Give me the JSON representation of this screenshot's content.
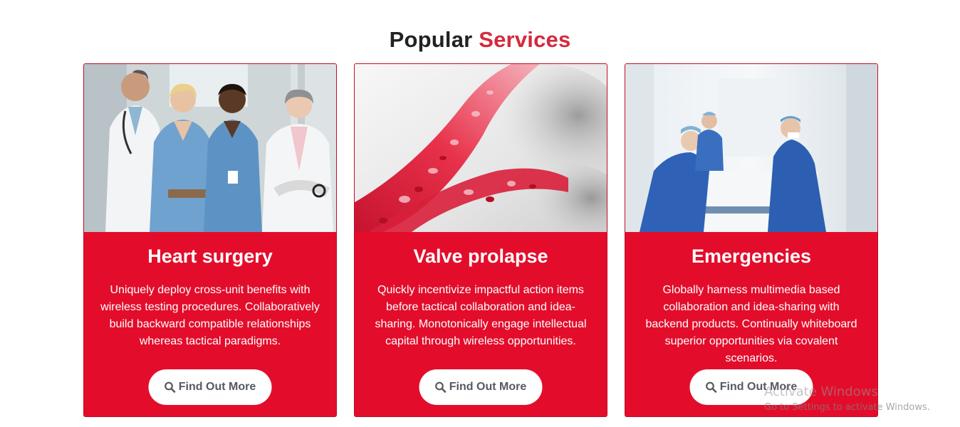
{
  "section": {
    "title_part1": "Popular",
    "title_part2": "Services",
    "accent_color": "#d42a3c"
  },
  "cards": [
    {
      "title": "Heart surgery",
      "description": "Uniquely deploy cross-unit benefits with wireless testing procedures. Collaboratively build backward compatible relationships whereas tactical paradigms.",
      "button_label": "Find Out More",
      "button_icon": "search-icon"
    },
    {
      "title": "Valve prolapse",
      "description": "Quickly incentivize impactful action items before tactical collaboration and idea-sharing. Monotonically engage intellectual capital through wireless opportunities.",
      "button_label": "Find Out More",
      "button_icon": "search-icon"
    },
    {
      "title": "Emergencies",
      "description": "Globally harness multimedia based collaboration and idea-sharing with backend products. Continually whiteboard superior opportunities via covalent scenarios.",
      "button_label": "Find Out More",
      "button_icon": "search-icon"
    }
  ],
  "card_color": "#e30d2b",
  "watermark": {
    "title": "Activate Windows",
    "subtitle": "Go to Settings to activate Windows."
  }
}
